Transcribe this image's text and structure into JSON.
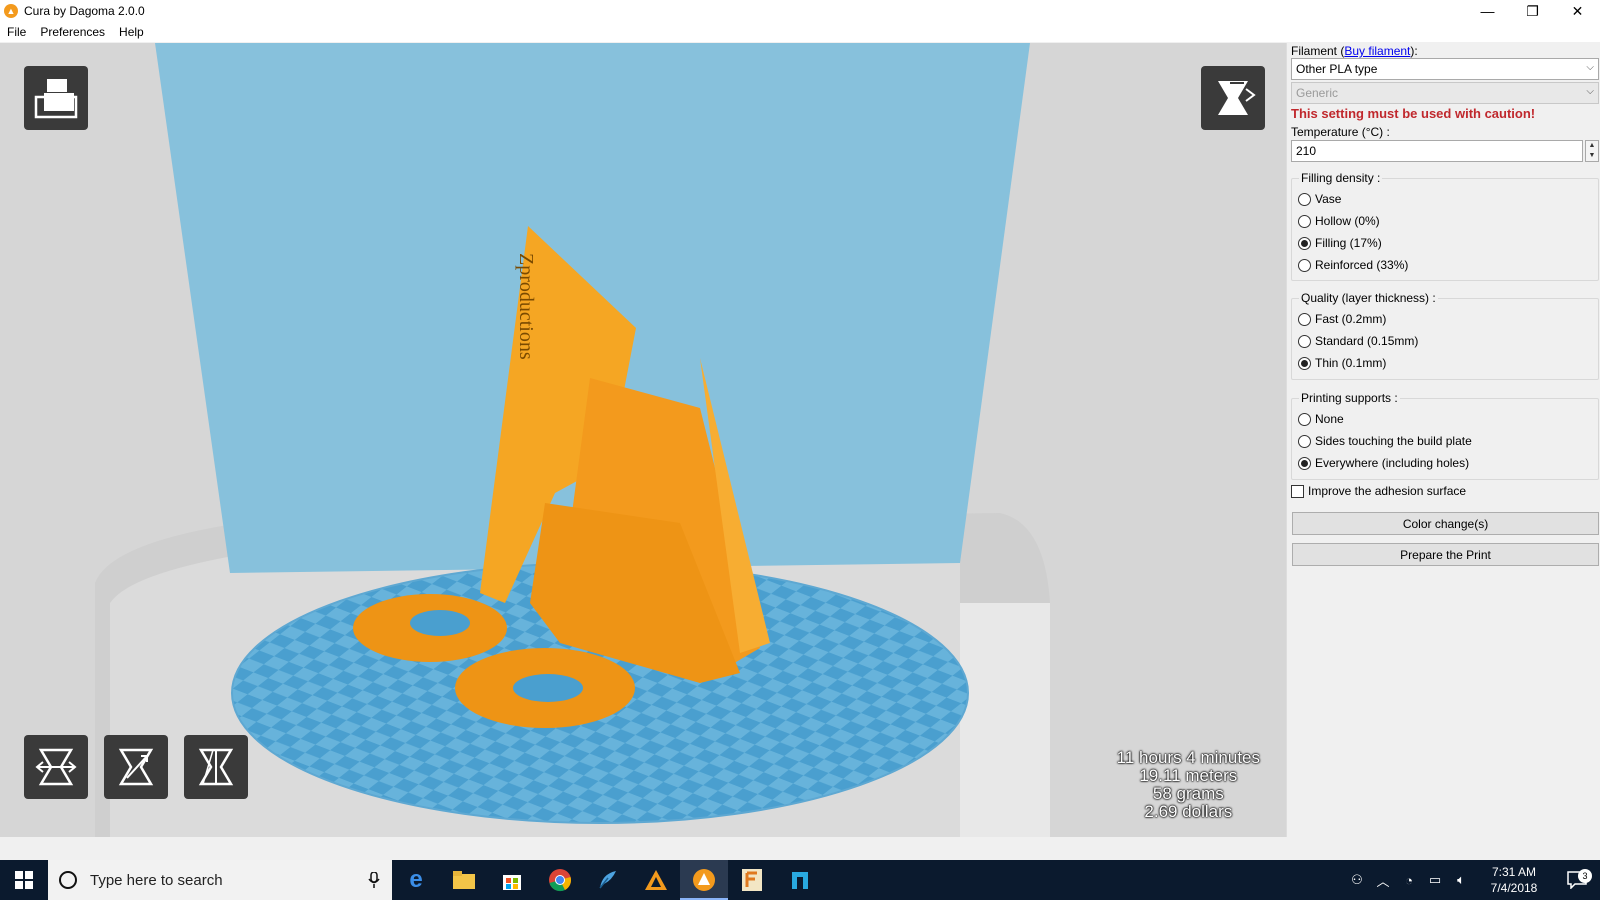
{
  "window": {
    "title": "Cura by Dagoma 2.0.0",
    "controls": {
      "minimize": "—",
      "restore": "❐",
      "close": "✕"
    }
  },
  "menu": [
    "File",
    "Preferences",
    "Help"
  ],
  "viewport": {
    "model_text": "Zproductions",
    "stats": {
      "time": "11 hours 4 minutes",
      "length": "19.11 meters",
      "weight": "58 grams",
      "cost": "2.69 dollars"
    }
  },
  "panel": {
    "filament_label_prefix": "Filament (",
    "buy_link": "Buy filament",
    "filament_label_suffix": "):",
    "filament_type": "Other PLA type",
    "filament_brand": "Generic",
    "warning": "This setting must be used with caution!",
    "temperature_label": "Temperature (°C) :",
    "temperature_value": "210",
    "filling": {
      "title": "Filling density :",
      "options": [
        "Vase",
        "Hollow (0%)",
        "Filling (17%)",
        "Reinforced (33%)"
      ],
      "selected": 2
    },
    "quality": {
      "title": "Quality (layer thickness) :",
      "options": [
        "Fast (0.2mm)",
        "Standard (0.15mm)",
        "Thin (0.1mm)"
      ],
      "selected": 2
    },
    "supports": {
      "title": "Printing supports :",
      "options": [
        "None",
        "Sides touching the build plate",
        "Everywhere (including holes)"
      ],
      "selected": 2
    },
    "adhesion_label": "Improve the adhesion surface",
    "color_change_button": "Color change(s)",
    "prepare_button": "Prepare the Print"
  },
  "taskbar": {
    "search_placeholder": "Type here to search",
    "time": "7:31 AM",
    "date": "7/4/2018",
    "notification_count": "3"
  },
  "colors": {
    "accent_orange": "#f39a1d",
    "build_volume": "#87c1dc",
    "warning": "#c0282d"
  }
}
